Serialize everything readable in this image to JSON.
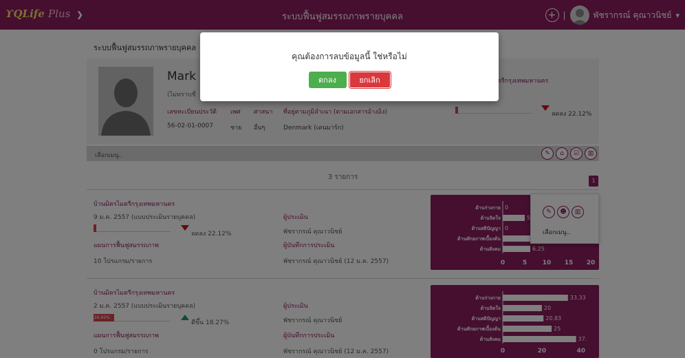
{
  "topbar": {
    "logo_main": "QLife",
    "logo_plus": "Plus",
    "app_title": "ระบบฟื้นฟูสมรรถภาพรายบุคคล",
    "user_name": "พัชรากรณ์ คุณาวนิชย์"
  },
  "page": {
    "title": "ระบบฟื้นฟูสมรรถภาพรายบุคคล",
    "profile": {
      "name": "Mark",
      "name_note": "(ไม่ทราบชื่",
      "id_label": "เลขทะเบียนประวัติ",
      "id_value": "56-02-01-0007",
      "sex_label": "เพศ",
      "sex_value": "ชาย",
      "religion_label": "ศาสนา",
      "religion_value": "อื่นๆ",
      "address_label": "ที่อยู่ตามภูมิลำเนา (ตามเอกสารอ้างอิง)",
      "address_value": "Denmark (เดนมาร์ก)",
      "org": "ตรีกรุงเทพมหานคร",
      "mini_score": 4,
      "trend_text": "ลดลง 22.12%",
      "trend_color": "#c9141c"
    },
    "menu_label": "เลือกเมนู..",
    "record_count": "3 รายการ",
    "page_number": "1",
    "records": [
      {
        "org": "บ้านมิตรไมตรีกรุงเทพมหานคร",
        "date_type": "9 ม.ค. 2557 (แบบประเมินรายบุคคล)",
        "score": 4,
        "score_text": "",
        "trend_text": "ลดลง 22.12%",
        "trend_dir": "down",
        "plan_label": "แผนการฟื้นฟูสมรรถภาพ",
        "plan_value": "10 โปรแกรม/รายการ",
        "assessor_label": "ผู้ประเมิน",
        "assessor_value": "พัชรากรณ์ คุณาวนิชย์",
        "recorder_label": "ผู้บันทึกการประเมิน",
        "recorder_value": "พัชรากรณ์ คุณาวนิชย์ (12 ม.ค. 2557)"
      },
      {
        "org": "บ้านมิตรไมตรีกรุงเทพมหานคร",
        "date_type": "2 ม.ค. 2557 (แบบประเมินรายบุคคล)",
        "score": 26.92,
        "score_text": "26.92%",
        "trend_text": "ดีขึ้น 18.27%",
        "trend_dir": "up",
        "plan_label": "แผนการฟื้นฟูสมรรถภาพ",
        "plan_value": "0 โปรแกรม/รายการ",
        "assessor_label": "ผู้ประเมิน",
        "assessor_value": "พัชรากรณ์ คุณาวนิชย์",
        "recorder_label": "ผู้บันทึกการประเมิน",
        "recorder_value": "พัชรากรณ์ คุณาวนิชย์ (12 ม.ค. 2557)"
      }
    ],
    "popup_menu_label": "เลือกเมนู.."
  },
  "chart_data": [
    {
      "type": "bar",
      "orientation": "horizontal",
      "categories": [
        "ด้านร่างกาย",
        "ด้านจิตใจ",
        "ด้านสติปัญญา",
        "ด้านศักยภาพเบื้องต้น",
        "ด้านสังคม"
      ],
      "values": [
        0,
        5,
        0,
        14,
        6.25
      ],
      "value_labels": [
        "0",
        "5",
        "0",
        "",
        "6.25"
      ],
      "xticks": [
        "0",
        "5",
        "10",
        "15",
        "20"
      ],
      "xlim": [
        0,
        20
      ],
      "bar_color": "#ffffff",
      "background": "#8c1d5f"
    },
    {
      "type": "bar",
      "orientation": "horizontal",
      "categories": [
        "ด้านร่างกาย",
        "ด้านจิตใจ",
        "ด้านสติปัญญา",
        "ด้านศักยภาพเบื้องต้น",
        "ด้านสังคม"
      ],
      "values": [
        33.33,
        20,
        20.83,
        25,
        37.5
      ],
      "value_labels": [
        "33.33",
        "20",
        "20.83",
        "25",
        "37."
      ],
      "xticks": [
        "0",
        "20",
        "40"
      ],
      "xlim": [
        0,
        45
      ],
      "bar_color": "#ffffff",
      "background": "#8c1d5f"
    }
  ],
  "dialog": {
    "message": "คุณต้องการลบข้อมูลนี้ ใช่หรือไม่",
    "ok_label": "ตกลง",
    "cancel_label": "ยกเลิก"
  }
}
